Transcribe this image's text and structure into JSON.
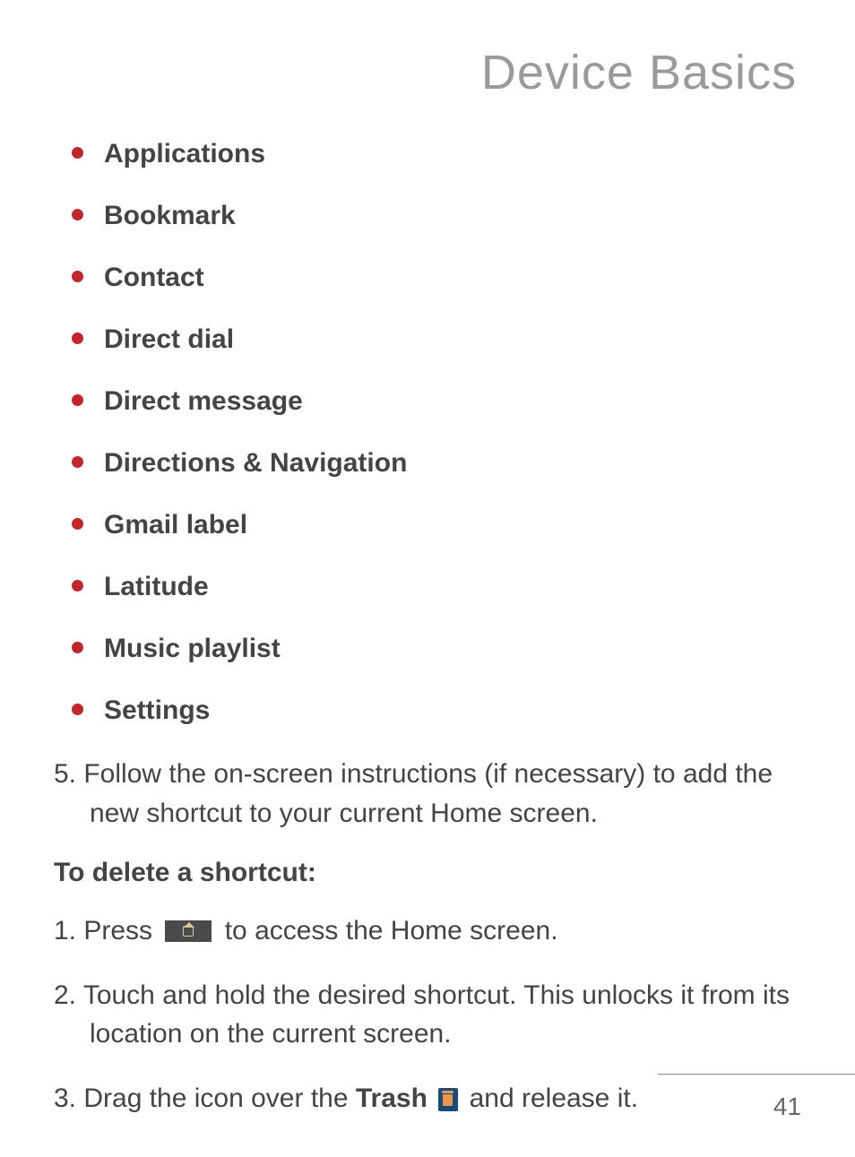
{
  "title": "Device Basics",
  "bullets": [
    "Applications",
    "Bookmark",
    "Contact",
    "Direct dial",
    "Direct message",
    "Directions & Navigation",
    "Gmail label",
    "Latitude",
    "Music playlist",
    "Settings"
  ],
  "step5": "5. Follow the on-screen instructions (if necessary) to add the new shortcut to your current Home screen.",
  "subheading": "To delete a shortcut:",
  "step1_a": "1. Press ",
  "step1_b": " to access the Home screen.",
  "step2": "2. Touch and hold the desired shortcut. This unlocks it from its location on the current screen.",
  "step3_a": "3. Drag the icon over the ",
  "step3_bold": "Trash",
  "step3_b": " and release it.",
  "page_number": "41"
}
